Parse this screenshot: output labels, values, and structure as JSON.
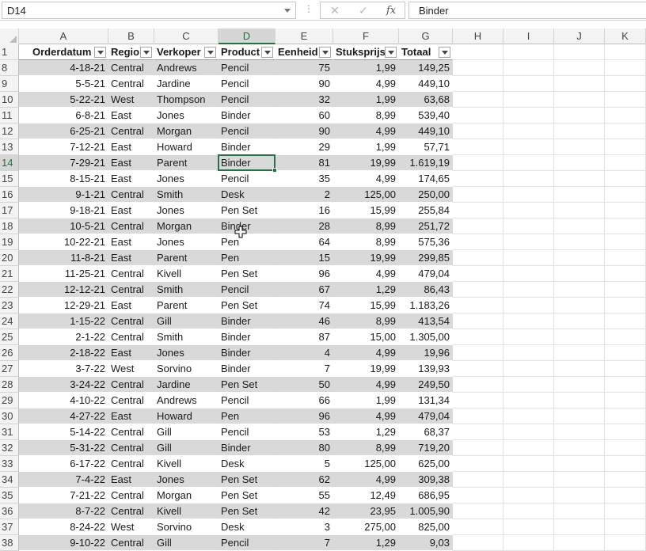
{
  "formula_bar": {
    "name_box": "D14",
    "fx_label": "fx",
    "cancel_glyph": "✕",
    "enter_glyph": "✓",
    "formula_value": "Binder"
  },
  "columns": [
    {
      "letter": "A",
      "header": "Orderdatum"
    },
    {
      "letter": "B",
      "header": "Regio"
    },
    {
      "letter": "C",
      "header": "Verkoper"
    },
    {
      "letter": "D",
      "header": "Product"
    },
    {
      "letter": "E",
      "header": "Eenheid"
    },
    {
      "letter": "F",
      "header": "Stuksprijs"
    },
    {
      "letter": "G",
      "header": "Totaal"
    },
    {
      "letter": "H",
      "header": ""
    },
    {
      "letter": "I",
      "header": ""
    },
    {
      "letter": "J",
      "header": ""
    },
    {
      "letter": "K",
      "header": ""
    }
  ],
  "active_cell": {
    "row": "14",
    "col": "D"
  },
  "header_row_number": "1",
  "rows": [
    [
      "8",
      "4-18-21",
      "Central",
      "Andrews",
      "Pencil",
      "75",
      "1,99",
      "149,25"
    ],
    [
      "9",
      "5-5-21",
      "Central",
      "Jardine",
      "Pencil",
      "90",
      "4,99",
      "449,10"
    ],
    [
      "10",
      "5-22-21",
      "West",
      "Thompson",
      "Pencil",
      "32",
      "1,99",
      "63,68"
    ],
    [
      "11",
      "6-8-21",
      "East",
      "Jones",
      "Binder",
      "60",
      "8,99",
      "539,40"
    ],
    [
      "12",
      "6-25-21",
      "Central",
      "Morgan",
      "Pencil",
      "90",
      "4,99",
      "449,10"
    ],
    [
      "13",
      "7-12-21",
      "East",
      "Howard",
      "Binder",
      "29",
      "1,99",
      "57,71"
    ],
    [
      "14",
      "7-29-21",
      "East",
      "Parent",
      "Binder",
      "81",
      "19,99",
      "1.619,19"
    ],
    [
      "15",
      "8-15-21",
      "East",
      "Jones",
      "Pencil",
      "35",
      "4,99",
      "174,65"
    ],
    [
      "16",
      "9-1-21",
      "Central",
      "Smith",
      "Desk",
      "2",
      "125,00",
      "250,00"
    ],
    [
      "17",
      "9-18-21",
      "East",
      "Jones",
      "Pen Set",
      "16",
      "15,99",
      "255,84"
    ],
    [
      "18",
      "10-5-21",
      "Central",
      "Morgan",
      "Binder",
      "28",
      "8,99",
      "251,72"
    ],
    [
      "19",
      "10-22-21",
      "East",
      "Jones",
      "Pen",
      "64",
      "8,99",
      "575,36"
    ],
    [
      "20",
      "11-8-21",
      "East",
      "Parent",
      "Pen",
      "15",
      "19,99",
      "299,85"
    ],
    [
      "21",
      "11-25-21",
      "Central",
      "Kivell",
      "Pen Set",
      "96",
      "4,99",
      "479,04"
    ],
    [
      "22",
      "12-12-21",
      "Central",
      "Smith",
      "Pencil",
      "67",
      "1,29",
      "86,43"
    ],
    [
      "23",
      "12-29-21",
      "East",
      "Parent",
      "Pen Set",
      "74",
      "15,99",
      "1.183,26"
    ],
    [
      "24",
      "1-15-22",
      "Central",
      "Gill",
      "Binder",
      "46",
      "8,99",
      "413,54"
    ],
    [
      "25",
      "2-1-22",
      "Central",
      "Smith",
      "Binder",
      "87",
      "15,00",
      "1.305,00"
    ],
    [
      "26",
      "2-18-22",
      "East",
      "Jones",
      "Binder",
      "4",
      "4,99",
      "19,96"
    ],
    [
      "27",
      "3-7-22",
      "West",
      "Sorvino",
      "Binder",
      "7",
      "19,99",
      "139,93"
    ],
    [
      "28",
      "3-24-22",
      "Central",
      "Jardine",
      "Pen Set",
      "50",
      "4,99",
      "249,50"
    ],
    [
      "29",
      "4-10-22",
      "Central",
      "Andrews",
      "Pencil",
      "66",
      "1,99",
      "131,34"
    ],
    [
      "30",
      "4-27-22",
      "East",
      "Howard",
      "Pen",
      "96",
      "4,99",
      "479,04"
    ],
    [
      "31",
      "5-14-22",
      "Central",
      "Gill",
      "Pencil",
      "53",
      "1,29",
      "68,37"
    ],
    [
      "32",
      "5-31-22",
      "Central",
      "Gill",
      "Binder",
      "80",
      "8,99",
      "719,20"
    ],
    [
      "33",
      "6-17-22",
      "Central",
      "Kivell",
      "Desk",
      "5",
      "125,00",
      "625,00"
    ],
    [
      "34",
      "7-4-22",
      "East",
      "Jones",
      "Pen Set",
      "62",
      "4,99",
      "309,38"
    ],
    [
      "35",
      "7-21-22",
      "Central",
      "Morgan",
      "Pen Set",
      "55",
      "12,49",
      "686,95"
    ],
    [
      "36",
      "8-7-22",
      "Central",
      "Kivell",
      "Pen Set",
      "42",
      "23,95",
      "1.005,90"
    ],
    [
      "37",
      "8-24-22",
      "West",
      "Sorvino",
      "Desk",
      "3",
      "275,00",
      "825,00"
    ],
    [
      "38",
      "9-10-22",
      "Central",
      "Gill",
      "Pencil",
      "7",
      "1,29",
      "9,03"
    ]
  ],
  "colors": {
    "accent": "#217346",
    "band": "#d9d9d9",
    "header_bg": "#f3f3f3"
  }
}
